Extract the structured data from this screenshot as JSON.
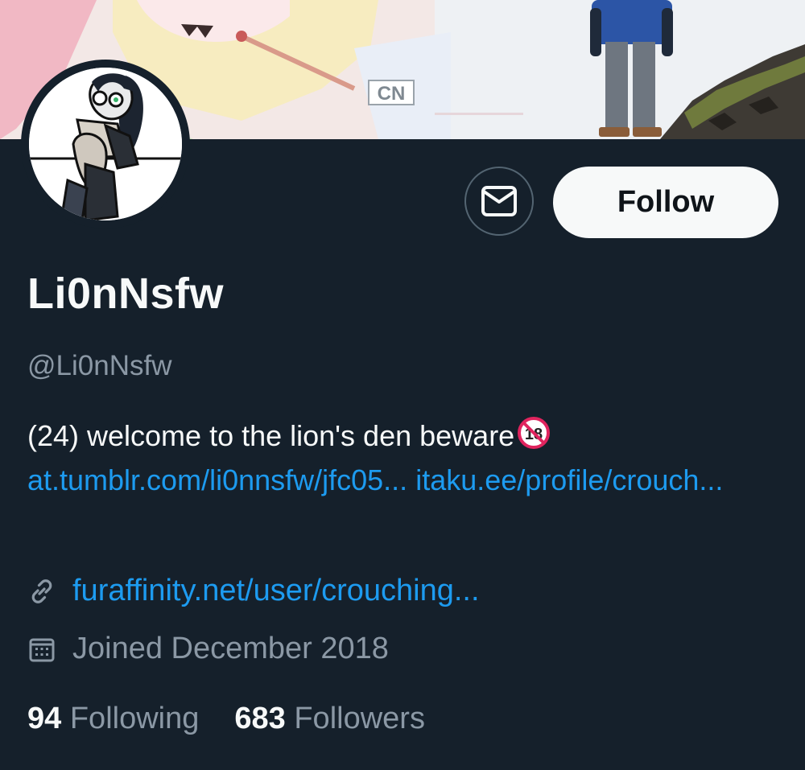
{
  "profile": {
    "display_name": "Li0nNsfw",
    "handle": "@Li0nNsfw",
    "bio_text": "(24) welcome to the lion's den beware",
    "bio_badge": "18",
    "bio_links": [
      "at.tumblr.com/li0nnsfw/jfc05...",
      "itaku.ee/profile/crouch..."
    ],
    "website": "furaffinity.net/user/crouching...",
    "joined": "Joined December 2018",
    "following_count": "94",
    "following_label": "Following",
    "followers_count": "683",
    "followers_label": "Followers"
  },
  "actions": {
    "follow_label": "Follow",
    "message_icon": "envelope-icon"
  },
  "banner": {
    "watermark": "CN"
  },
  "colors": {
    "background": "#15202b",
    "link": "#1d9bf0",
    "secondary_text": "#8b98a5",
    "primary_text": "#f7f9f9",
    "follow_button_bg": "#f7f9f9"
  }
}
